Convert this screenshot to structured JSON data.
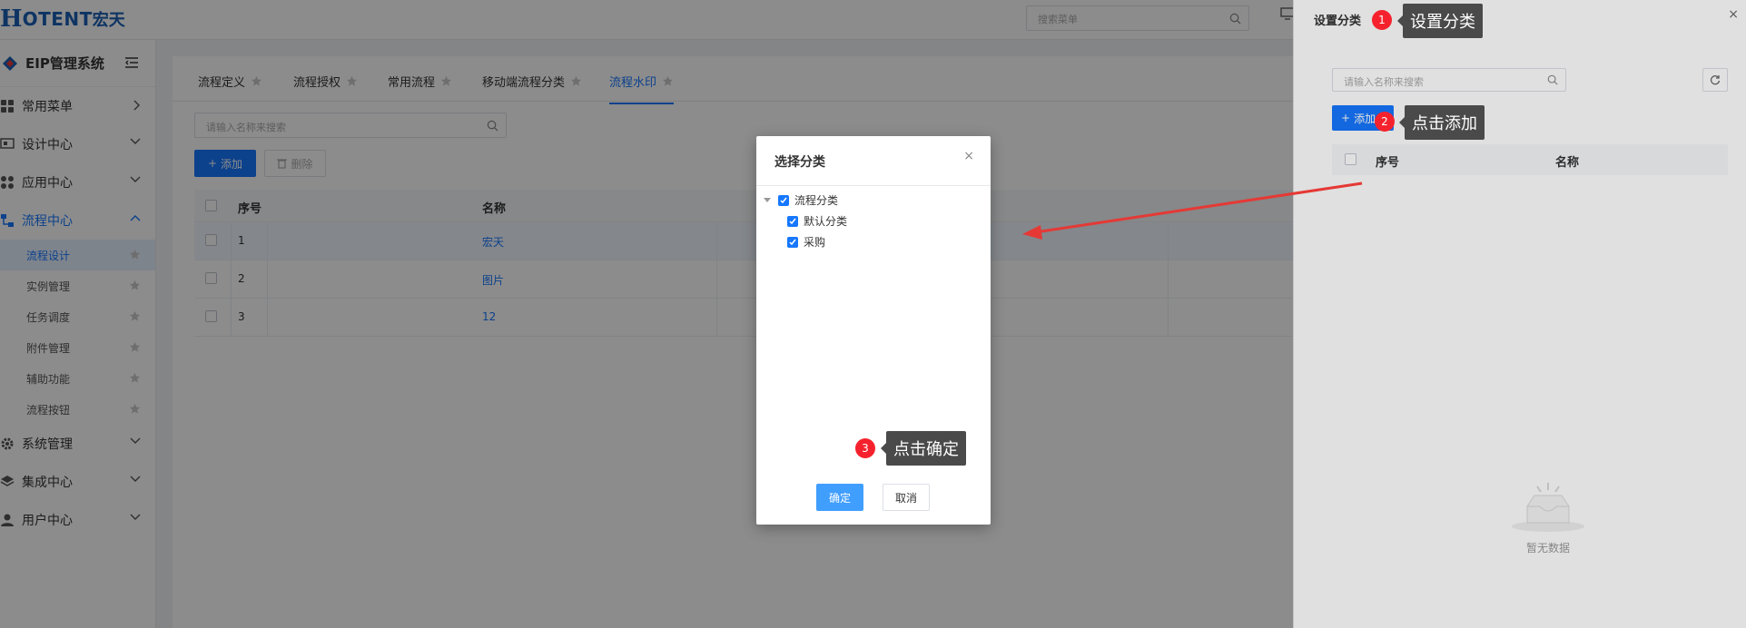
{
  "brand": {
    "mark": "H",
    "name": "OTENT",
    "cn": "宏天"
  },
  "top_search": {
    "placeholder": "搜索菜单"
  },
  "sidebar": {
    "system_title": "EIP管理系统",
    "menus": [
      {
        "label": "常用菜单",
        "icon": "grid-icon",
        "state": "collapsed"
      },
      {
        "label": "设计中心",
        "icon": "design-icon",
        "state": "collapsed"
      },
      {
        "label": "应用中心",
        "icon": "apps-icon",
        "state": "collapsed"
      },
      {
        "label": "流程中心",
        "icon": "flow-icon",
        "state": "expanded"
      }
    ],
    "flow_sub_items": [
      "流程设计",
      "实例管理",
      "任务调度",
      "附件管理",
      "辅助功能",
      "流程按钮"
    ],
    "menus_after": [
      {
        "label": "系统管理",
        "icon": "gear-icon"
      },
      {
        "label": "集成中心",
        "icon": "layers-icon"
      },
      {
        "label": "用户中心",
        "icon": "user-icon"
      }
    ]
  },
  "tabs": [
    "流程定义",
    "流程授权",
    "常用流程",
    "移动端流程分类",
    "流程水印"
  ],
  "active_tab": "流程水印",
  "main": {
    "search_placeholder": "请输入名称来搜索",
    "add_label": "添加",
    "delete_label": "删除",
    "columns": [
      "序号",
      "名称"
    ],
    "rows": [
      {
        "no": "1",
        "name": "宏天"
      },
      {
        "no": "2",
        "name": "图片"
      },
      {
        "no": "3",
        "name": "12"
      }
    ]
  },
  "drawer": {
    "title": "设置分类",
    "search_placeholder": "请输入名称来搜索",
    "add_label": "添加",
    "columns": [
      "序号",
      "名称"
    ],
    "empty_text": "暂无数据"
  },
  "dialog": {
    "title": "选择分类",
    "tree": {
      "root": "流程分类",
      "children": [
        "默认分类",
        "采购"
      ]
    },
    "ok_label": "确定",
    "cancel_label": "取消"
  },
  "annotations": [
    {
      "step": "1",
      "text": "设置分类"
    },
    {
      "step": "2",
      "text": "点击添加"
    },
    {
      "step": "3",
      "text": "点击确定"
    }
  ],
  "colors": {
    "primary": "#1677ff",
    "annotation_badge": "#f5222d",
    "callout_bg": "#4a4a4a",
    "arrow": "#e53935"
  }
}
